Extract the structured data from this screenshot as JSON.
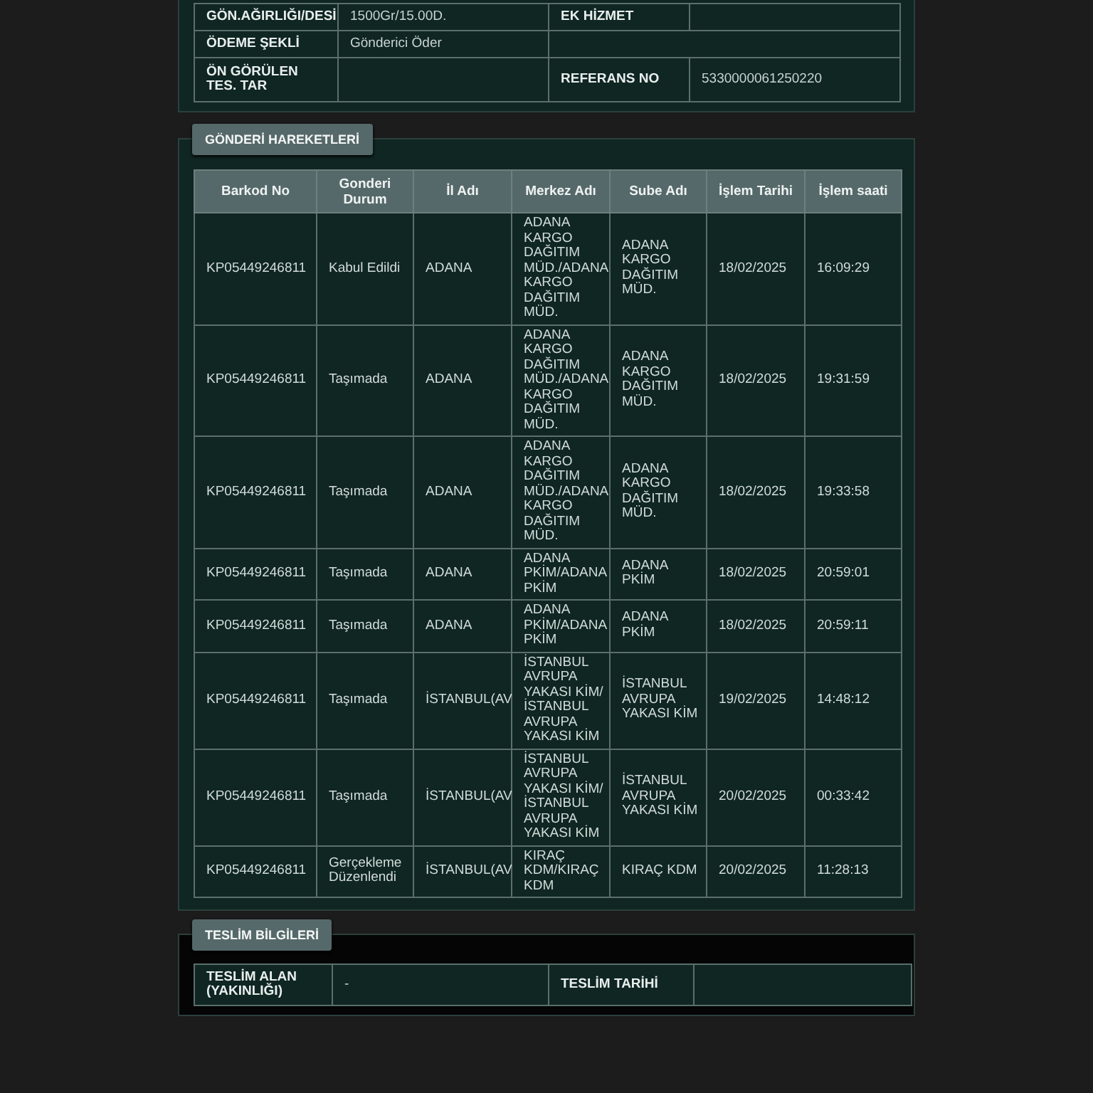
{
  "shipment_info": [
    {
      "cells": [
        {
          "kind": "label",
          "text": "GÖN.AĞIRLIĞI/DESİ"
        },
        {
          "kind": "value",
          "text": "1500Gr/15.00D."
        },
        {
          "kind": "label",
          "text": "EK HİZMET"
        },
        {
          "kind": "value",
          "text": ""
        }
      ]
    },
    {
      "cells": [
        {
          "kind": "label",
          "text": "ÖDEME ŞEKLİ"
        },
        {
          "kind": "value",
          "text": "Gönderici Öder"
        },
        {
          "kind": "wide",
          "text": ""
        }
      ]
    },
    {
      "cells": [
        {
          "kind": "label",
          "text": "ÖN GÖRÜLEN TES. TAR"
        },
        {
          "kind": "value",
          "text": ""
        },
        {
          "kind": "label",
          "text": "REFERANS NO"
        },
        {
          "kind": "value",
          "text": "5330000061250220"
        }
      ]
    }
  ],
  "movements": {
    "title": "GÖNDERİ HAREKETLERİ",
    "columns": [
      "Barkod No",
      "Gonderi Durum",
      "İl Adı",
      "Merkez Adı",
      "Sube Adı",
      "İşlem Tarihi",
      "İşlem saati"
    ],
    "rows": [
      [
        "KP05449246811",
        "Kabul Edildi",
        "ADANA",
        "ADANA KARGO DAĞITIM MÜD./ADANA KARGO DAĞITIM MÜD.",
        "ADANA KARGO DAĞITIM MÜD.",
        "18/02/2025",
        "16:09:29"
      ],
      [
        "KP05449246811",
        "Taşımada",
        "ADANA",
        "ADANA KARGO DAĞITIM MÜD./ADANA KARGO DAĞITIM MÜD.",
        "ADANA KARGO DAĞITIM MÜD.",
        "18/02/2025",
        "19:31:59"
      ],
      [
        "KP05449246811",
        "Taşımada",
        "ADANA",
        "ADANA KARGO DAĞITIM MÜD./ADANA KARGO DAĞITIM MÜD.",
        "ADANA KARGO DAĞITIM MÜD.",
        "18/02/2025",
        "19:33:58"
      ],
      [
        "KP05449246811",
        "Taşımada",
        "ADANA",
        "ADANA PKİM/ADANA PKİM",
        "ADANA PKİM",
        "18/02/2025",
        "20:59:01"
      ],
      [
        "KP05449246811",
        "Taşımada",
        "ADANA",
        "ADANA PKİM/ADANA PKİM",
        "ADANA PKİM",
        "18/02/2025",
        "20:59:11"
      ],
      [
        "KP05449246811",
        "Taşımada",
        "İSTANBUL(AV",
        "İSTANBUL AVRUPA YAKASI KİM/ İSTANBUL AVRUPA YAKASI KİM",
        "İSTANBUL AVRUPA YAKASI KİM",
        "19/02/2025",
        "14:48:12"
      ],
      [
        "KP05449246811",
        "Taşımada",
        "İSTANBUL(AV",
        "İSTANBUL AVRUPA YAKASI KİM/ İSTANBUL AVRUPA YAKASI KİM",
        "İSTANBUL AVRUPA YAKASI KİM",
        "20/02/2025",
        "00:33:42"
      ],
      [
        "KP05449246811",
        "Gerçekleme Düzenlendi",
        "İSTANBUL(AV",
        "KIRAÇ KDM/KIRAÇ KDM",
        "KIRAÇ KDM",
        "20/02/2025",
        "11:28:13"
      ]
    ]
  },
  "delivery": {
    "title": "TESLİM BİLGİLERİ",
    "cells": [
      {
        "kind": "label",
        "text": "TESLİM ALAN (YAKINLIĞI)"
      },
      {
        "kind": "value",
        "text": "-"
      },
      {
        "kind": "label",
        "text": "TESLİM TARİHİ"
      },
      {
        "kind": "value",
        "text": ""
      }
    ]
  }
}
